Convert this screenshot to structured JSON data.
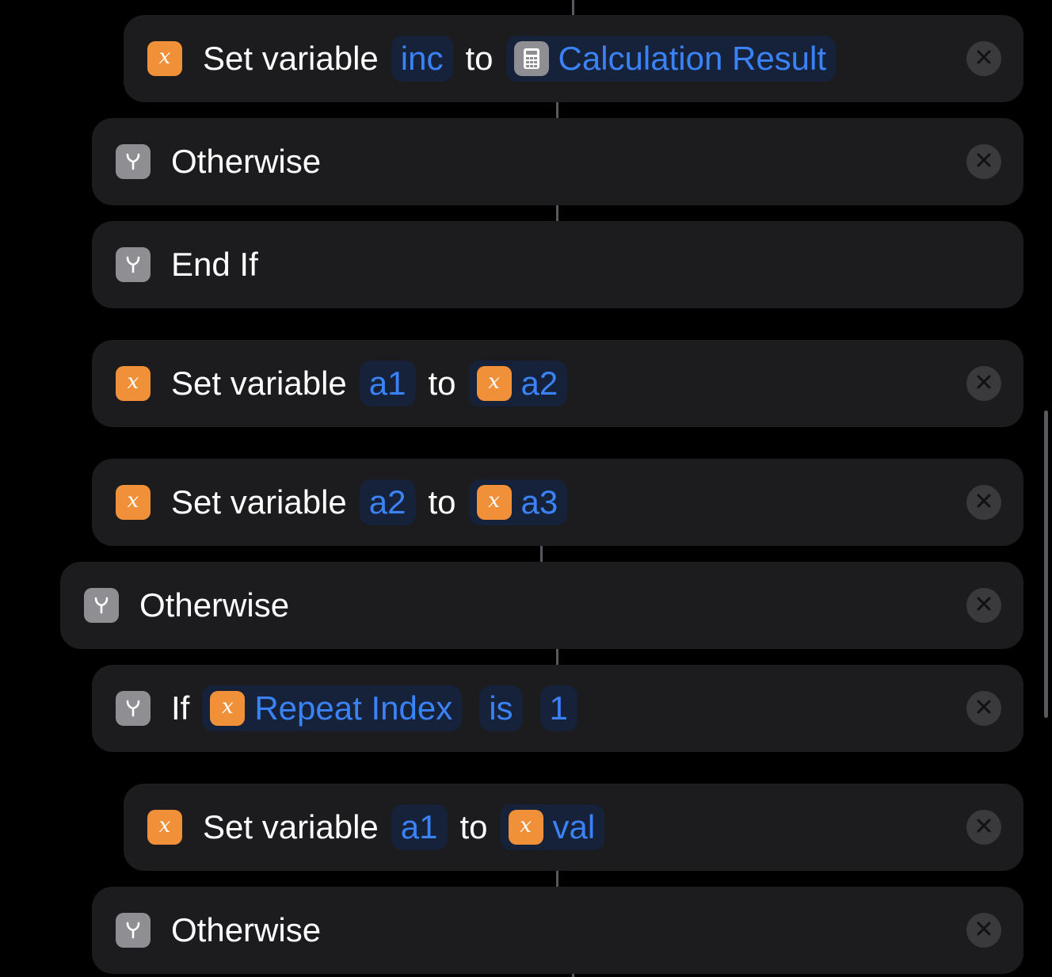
{
  "icons": {
    "variable": "x-variable-icon",
    "control": "branch-icon",
    "calculate": "calculator-icon",
    "remove": "close-icon"
  },
  "colors": {
    "background": "#000000",
    "card": "#1c1c1e",
    "variable_icon": "#f0913a",
    "control_icon": "#8e8e93",
    "token_text": "#3b82f6",
    "token_bg": "#15223a"
  },
  "actions": [
    {
      "kind": "set-variable",
      "verb": "Set variable",
      "name": "inc",
      "connector": "to",
      "value_icon": "calculator-icon",
      "value": "Calculation Result"
    },
    {
      "kind": "otherwise",
      "label": "Otherwise"
    },
    {
      "kind": "end-if",
      "label": "End If"
    },
    {
      "kind": "set-variable",
      "verb": "Set variable",
      "name": "a1",
      "connector": "to",
      "value_icon": "x-variable-icon",
      "value": "a2"
    },
    {
      "kind": "set-variable",
      "verb": "Set variable",
      "name": "a2",
      "connector": "to",
      "value_icon": "x-variable-icon",
      "value": "a3"
    },
    {
      "kind": "otherwise",
      "label": "Otherwise"
    },
    {
      "kind": "if",
      "label": "If",
      "subject_icon": "x-variable-icon",
      "subject": "Repeat Index",
      "condition": "is",
      "value": "1"
    },
    {
      "kind": "set-variable",
      "verb": "Set variable",
      "name": "a1",
      "connector": "to",
      "value_icon": "x-variable-icon",
      "value": "val"
    },
    {
      "kind": "otherwise",
      "label": "Otherwise"
    }
  ]
}
